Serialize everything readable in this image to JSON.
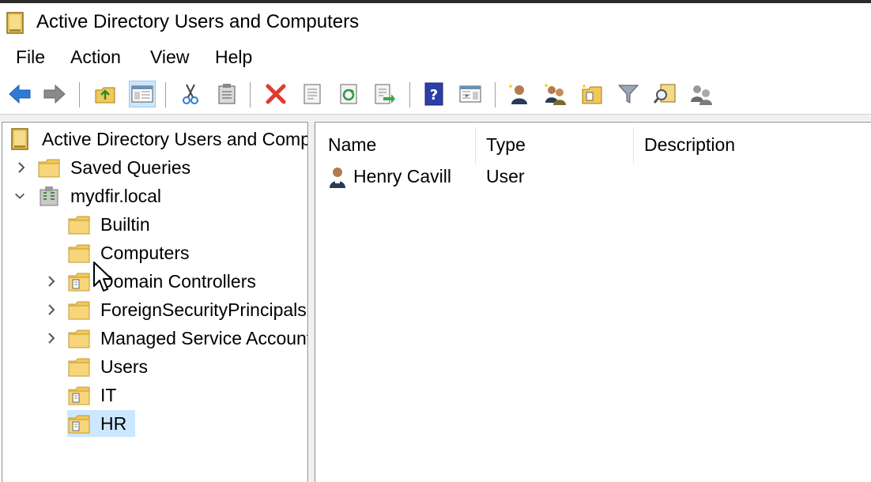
{
  "window": {
    "title": "Active Directory Users and Computers"
  },
  "menu": {
    "items": [
      "File",
      "Action",
      "View",
      "Help"
    ]
  },
  "toolbar": {
    "icons": [
      "back-arrow-icon",
      "forward-arrow-icon",
      "up-folder-icon",
      "show-hide-console-tree-icon",
      "cut-icon",
      "paste-icon",
      "delete-icon",
      "properties-icon",
      "refresh-icon",
      "export-list-icon",
      "help-icon",
      "show-hide-action-pane-icon",
      "create-user-icon",
      "create-group-icon",
      "create-ou-icon",
      "filter-icon",
      "find-icon",
      "delegate-control-icon"
    ]
  },
  "tree": {
    "root": "Active Directory Users and Computers",
    "items": [
      {
        "label": "Saved Queries",
        "type": "folder",
        "expandable": true,
        "expanded": false
      },
      {
        "label": "mydfir.local",
        "type": "domain",
        "expandable": true,
        "expanded": true
      },
      {
        "label": "Builtin",
        "type": "folder",
        "expandable": false
      },
      {
        "label": "Computers",
        "type": "folder",
        "expandable": false
      },
      {
        "label": "Domain Controllers",
        "type": "ou",
        "expandable": true
      },
      {
        "label": "ForeignSecurityPrincipals",
        "type": "folder",
        "expandable": true
      },
      {
        "label": "Managed Service Accounts",
        "type": "folder",
        "expandable": true
      },
      {
        "label": "Users",
        "type": "folder",
        "expandable": false
      },
      {
        "label": "IT",
        "type": "ou",
        "expandable": false
      },
      {
        "label": "HR",
        "type": "ou",
        "expandable": false,
        "selected": true
      }
    ]
  },
  "list": {
    "columns": [
      "Name",
      "Type",
      "Description"
    ],
    "rows": [
      {
        "name": "Henry Cavill",
        "type": "User",
        "description": ""
      }
    ]
  },
  "colors": {
    "selection": "#cce8ff",
    "folder": "#f3c85a",
    "delete": "#e03a2f",
    "arrow": "#2e7bd6"
  }
}
